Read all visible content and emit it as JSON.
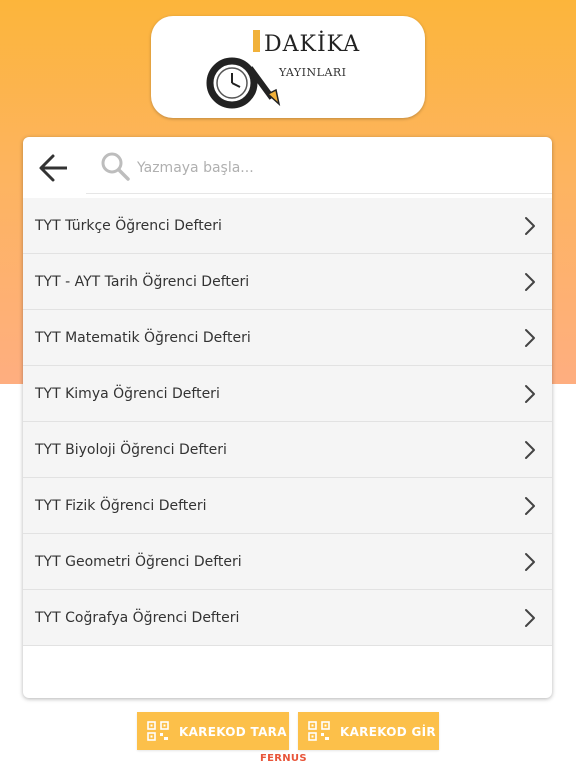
{
  "brand": {
    "title": "DAKİKA",
    "subtitle": "YAYINLARI",
    "footer": "FERNUS",
    "colors": {
      "accent": "#fcc04a",
      "footer": "#e8553a",
      "gradient_top": "#fcb53b",
      "gradient_bottom": "#feae80"
    }
  },
  "search": {
    "placeholder": "Yazmaya başla...",
    "value": ""
  },
  "list": {
    "items": [
      {
        "label": "TYT Türkçe Öğrenci Defteri"
      },
      {
        "label": "TYT - AYT Tarih Öğrenci Defteri"
      },
      {
        "label": "TYT Matematik Öğrenci Defteri"
      },
      {
        "label": "TYT Kimya Öğrenci Defteri"
      },
      {
        "label": "TYT Biyoloji Öğrenci Defteri"
      },
      {
        "label": "TYT Fizik Öğrenci Defteri"
      },
      {
        "label": "TYT Geometri Öğrenci Defteri"
      },
      {
        "label": "TYT Coğrafya Öğrenci Defteri"
      }
    ]
  },
  "actions": {
    "scan_label": "KAREKOD TARA",
    "enter_label": "KAREKOD GİR"
  },
  "icons": [
    "back-arrow-icon",
    "search-icon",
    "chevron-right-icon",
    "qr-code-icon",
    "clock-pencil-logo-icon"
  ]
}
